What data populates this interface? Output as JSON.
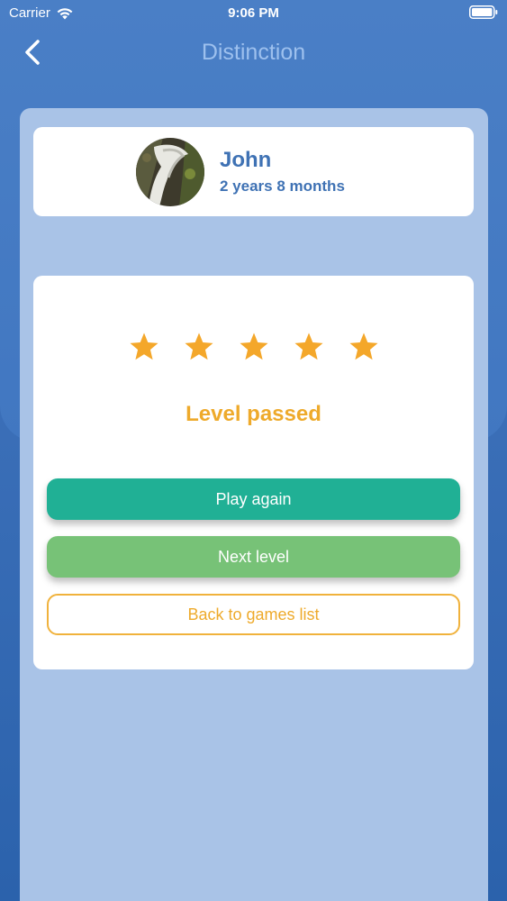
{
  "status_bar": {
    "carrier": "Carrier",
    "time": "9:06 PM"
  },
  "nav": {
    "title": "Distinction",
    "back_icon": "chevron-left-icon"
  },
  "profile": {
    "name": "John",
    "age": "2 years 8 months",
    "avatar_icon": "avatar-photo"
  },
  "result": {
    "rating": 5,
    "max_rating": 5,
    "title": "Level passed",
    "play_again_label": "Play again",
    "next_level_label": "Next level",
    "back_label": "Back to games list"
  },
  "colors": {
    "accent_orange": "#eeaa2b",
    "play_green": "#20b095",
    "next_green": "#77c277",
    "brand_blue": "#3f72b4"
  }
}
